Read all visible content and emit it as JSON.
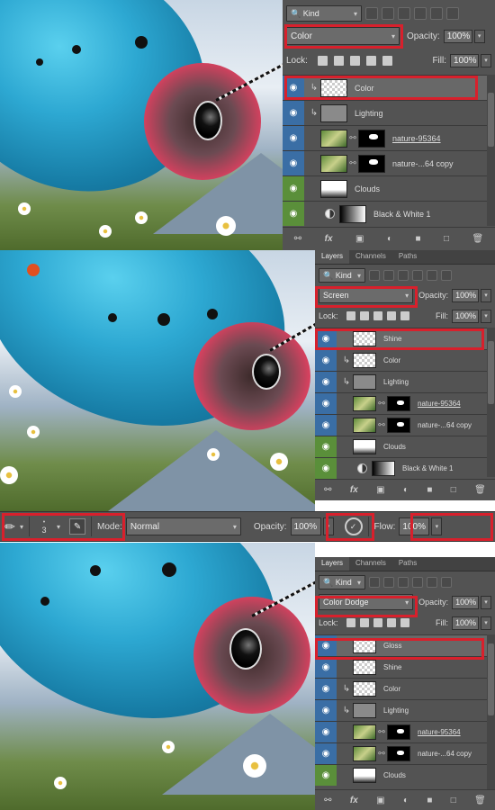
{
  "panels": [
    {
      "id": "panel1",
      "blend_mode": "Color",
      "opacity_label": "Opacity:",
      "opacity_value": "100%",
      "lock_label": "Lock:",
      "fill_label": "Fill:",
      "fill_value": "100%",
      "filter_label": "Kind",
      "layers": [
        {
          "name": "Color",
          "vis": "blue",
          "clip": true,
          "thumb": "checker",
          "selected": true
        },
        {
          "name": "Lighting",
          "vis": "blue",
          "clip": true,
          "thumb": "gray"
        },
        {
          "name": "nature-95364",
          "vis": "blue",
          "thumb": "photo",
          "mask": true,
          "underline": true
        },
        {
          "name": "nature-...64 copy",
          "vis": "blue",
          "thumb": "photo",
          "mask": true
        },
        {
          "name": "Clouds",
          "vis": "green",
          "thumb": "cloud"
        },
        {
          "name": "Black & White 1",
          "vis": "green",
          "thumb": "grad",
          "adjustment": true
        }
      ]
    },
    {
      "id": "panel2",
      "tabs": [
        "Layers",
        "Channels",
        "Paths"
      ],
      "blend_mode": "Screen",
      "opacity_label": "Opacity:",
      "opacity_value": "100%",
      "lock_label": "Lock:",
      "fill_label": "Fill:",
      "fill_value": "100%",
      "filter_label": "Kind",
      "layers": [
        {
          "name": "Shine",
          "vis": "blue",
          "thumb": "checker",
          "selected": true
        },
        {
          "name": "Color",
          "vis": "blue",
          "clip": true,
          "thumb": "checker"
        },
        {
          "name": "Lighting",
          "vis": "blue",
          "clip": true,
          "thumb": "gray"
        },
        {
          "name": "nature-95364",
          "vis": "blue",
          "thumb": "photo",
          "mask": true,
          "underline": true
        },
        {
          "name": "nature-...64 copy",
          "vis": "blue",
          "thumb": "photo",
          "mask": true
        },
        {
          "name": "Clouds",
          "vis": "green",
          "thumb": "cloud"
        },
        {
          "name": "Black & White 1",
          "vis": "green",
          "thumb": "grad",
          "adjustment": true
        }
      ]
    },
    {
      "id": "panel3",
      "tabs": [
        "Layers",
        "Channels",
        "Paths"
      ],
      "blend_mode": "Color Dodge",
      "opacity_label": "Opacity:",
      "opacity_value": "100%",
      "lock_label": "Lock:",
      "fill_label": "Fill:",
      "fill_value": "100%",
      "filter_label": "Kind",
      "layers": [
        {
          "name": "Gloss",
          "vis": "blue",
          "thumb": "checker",
          "selected": true
        },
        {
          "name": "Shine",
          "vis": "blue",
          "thumb": "checker"
        },
        {
          "name": "Color",
          "vis": "blue",
          "clip": true,
          "thumb": "checker"
        },
        {
          "name": "Lighting",
          "vis": "blue",
          "clip": true,
          "thumb": "gray"
        },
        {
          "name": "nature-95364",
          "vis": "blue",
          "thumb": "photo",
          "mask": true,
          "underline": true
        },
        {
          "name": "nature-...64 copy",
          "vis": "blue",
          "thumb": "photo",
          "mask": true
        },
        {
          "name": "Clouds",
          "vis": "green",
          "thumb": "cloud"
        }
      ]
    }
  ],
  "options_bar": {
    "brush_size": "3",
    "mode_label": "Mode:",
    "mode_value": "Normal",
    "opacity_label": "Opacity:",
    "opacity_value": "100%",
    "flow_label": "Flow:",
    "flow_value": "100%"
  },
  "footer_icons": [
    "link-icon",
    "fx-icon",
    "mask-icon",
    "adjustment-icon",
    "folder-icon",
    "new-layer-icon",
    "trash-icon"
  ],
  "colors": {
    "highlight_red": "#d8202c",
    "eye_blue": "#3a6ea5",
    "eye_green": "#5a8f3a",
    "panel_bg": "#535353"
  }
}
